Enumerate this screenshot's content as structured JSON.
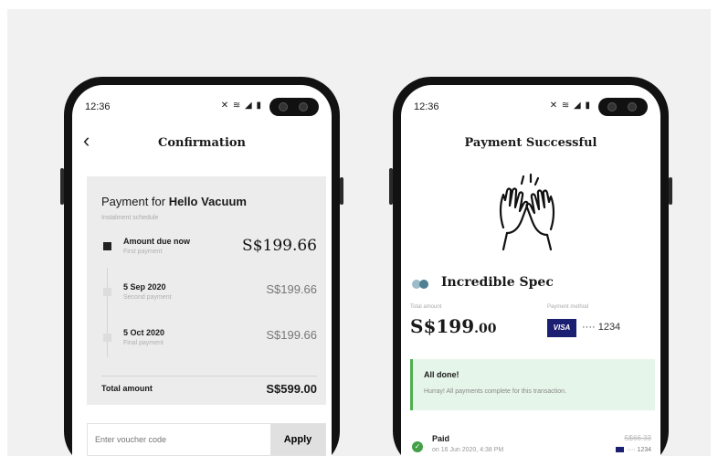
{
  "left_phone": {
    "status": {
      "time": "12:36",
      "icons": "✕ ≋ ◢ ▮"
    },
    "header": {
      "title": "Confirmation"
    },
    "payment": {
      "prefix": "Payment for",
      "merchant": "Hello Vacuum",
      "schedule_label": "Instalment schedule",
      "rows": [
        {
          "date": "Amount due now",
          "note": "First payment",
          "amount": "S$199.66"
        },
        {
          "date": "5 Sep 2020",
          "note": "Second payment",
          "amount": "S$199.66"
        },
        {
          "date": "5 Oct 2020",
          "note": "Final payment",
          "amount": "S$199.66"
        }
      ],
      "total_label": "Total amount",
      "total_amount": "S$599.00"
    },
    "voucher": {
      "placeholder": "Enter voucher code",
      "apply_label": "Apply"
    }
  },
  "right_phone": {
    "status": {
      "time": "12:36",
      "icons": "✕ ≋ ◢ ▮"
    },
    "header": {
      "title": "Payment Successful"
    },
    "merchant": "Incredible Spec",
    "total_label": "Total amount",
    "method_label": "Payment method",
    "amount_main": "S$199",
    "amount_cents": ".00",
    "card_brand": "VISA",
    "card_number": "···· 1234",
    "notice": {
      "title": "All done!",
      "message": "Hurray! All payments complete for this transaction."
    },
    "paid": {
      "label": "Paid",
      "when": "on 16 Jun 2020, 4:38 PM",
      "amount": "S$66.33",
      "card": "···· 1234"
    }
  },
  "colors": {
    "success_green": "#4caf50",
    "visa_blue": "#1a1f71",
    "card_bg": "#ececec",
    "merchant_dot_light": "#9bbcc9",
    "merchant_dot_dark": "#4f7f93"
  }
}
